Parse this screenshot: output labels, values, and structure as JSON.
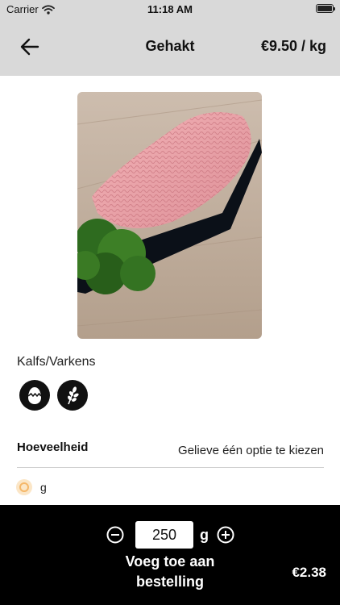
{
  "status_bar": {
    "carrier": "Carrier",
    "time": "11:18 AM"
  },
  "header": {
    "title": "Gehakt",
    "price_per_unit": "€9.50 / kg"
  },
  "product": {
    "description": "Kalfs/Varkens",
    "allergen_icons": [
      "egg-icon",
      "grain-icon"
    ]
  },
  "quantity": {
    "label": "Hoeveelheid",
    "hint": "Gelieve één optie te kiezen",
    "options": [
      {
        "label": "g",
        "selected": true
      }
    ]
  },
  "order_bar": {
    "amount": "250",
    "unit": "g",
    "add_label_line1": "Voeg toe aan",
    "add_label_line2": "bestelling",
    "total": "€2.38"
  },
  "colors": {
    "header_bg": "#d9d9d9",
    "bar_bg": "#000000",
    "radio_accent": "#f5b769"
  }
}
